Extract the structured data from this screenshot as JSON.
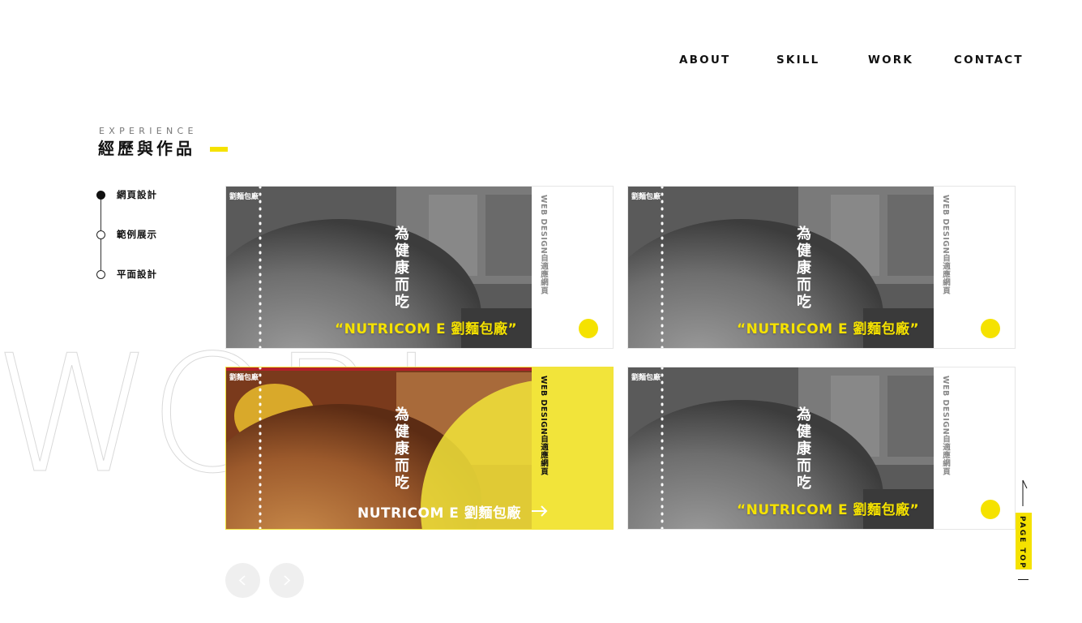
{
  "nav": {
    "items": [
      "ABOUT",
      "SKILL",
      "WORK",
      "CONTACT"
    ]
  },
  "heading": {
    "eyebrow": "EXPERIENCE",
    "title": "經歷與作品"
  },
  "side_menu": {
    "items": [
      {
        "label": "網頁設計",
        "active": true
      },
      {
        "label": "範例展示",
        "active": false
      },
      {
        "label": "平面設計",
        "active": false
      }
    ]
  },
  "background_word": "WORK",
  "cards": [
    {
      "tag": "WEB DESIGN自適應網頁",
      "quote": "“NUTRICOM E 劉麵包廠”",
      "style": "grayscale",
      "logo": "劉麵包廠",
      "calligraphy": "為健康而吃"
    },
    {
      "tag": "WEB DESIGN自適應網頁",
      "quote": "“NUTRICOM E 劉麵包廠”",
      "style": "grayscale",
      "logo": "劉麵包廠",
      "calligraphy": "為健康而吃"
    },
    {
      "tag": "WEB DESIGN自適應網頁",
      "quote": "NUTRICOM E 劉麵包廠",
      "style": "color-active",
      "logo": "劉麵包廠",
      "calligraphy": "為健康而吃"
    },
    {
      "tag": "WEB DESIGN自適應網頁",
      "quote": "“NUTRICOM E 劉麵包廠”",
      "style": "grayscale",
      "logo": "劉麵包廠",
      "calligraphy": "為健康而吃"
    }
  ],
  "pager": {
    "prev_icon": "chevron-left-icon",
    "next_icon": "chevron-right-icon"
  },
  "page_top": {
    "label": "PAGE TOP",
    "icon": "arrow-up-icon"
  },
  "colors": {
    "accent": "#f5e200",
    "text": "#111111"
  }
}
